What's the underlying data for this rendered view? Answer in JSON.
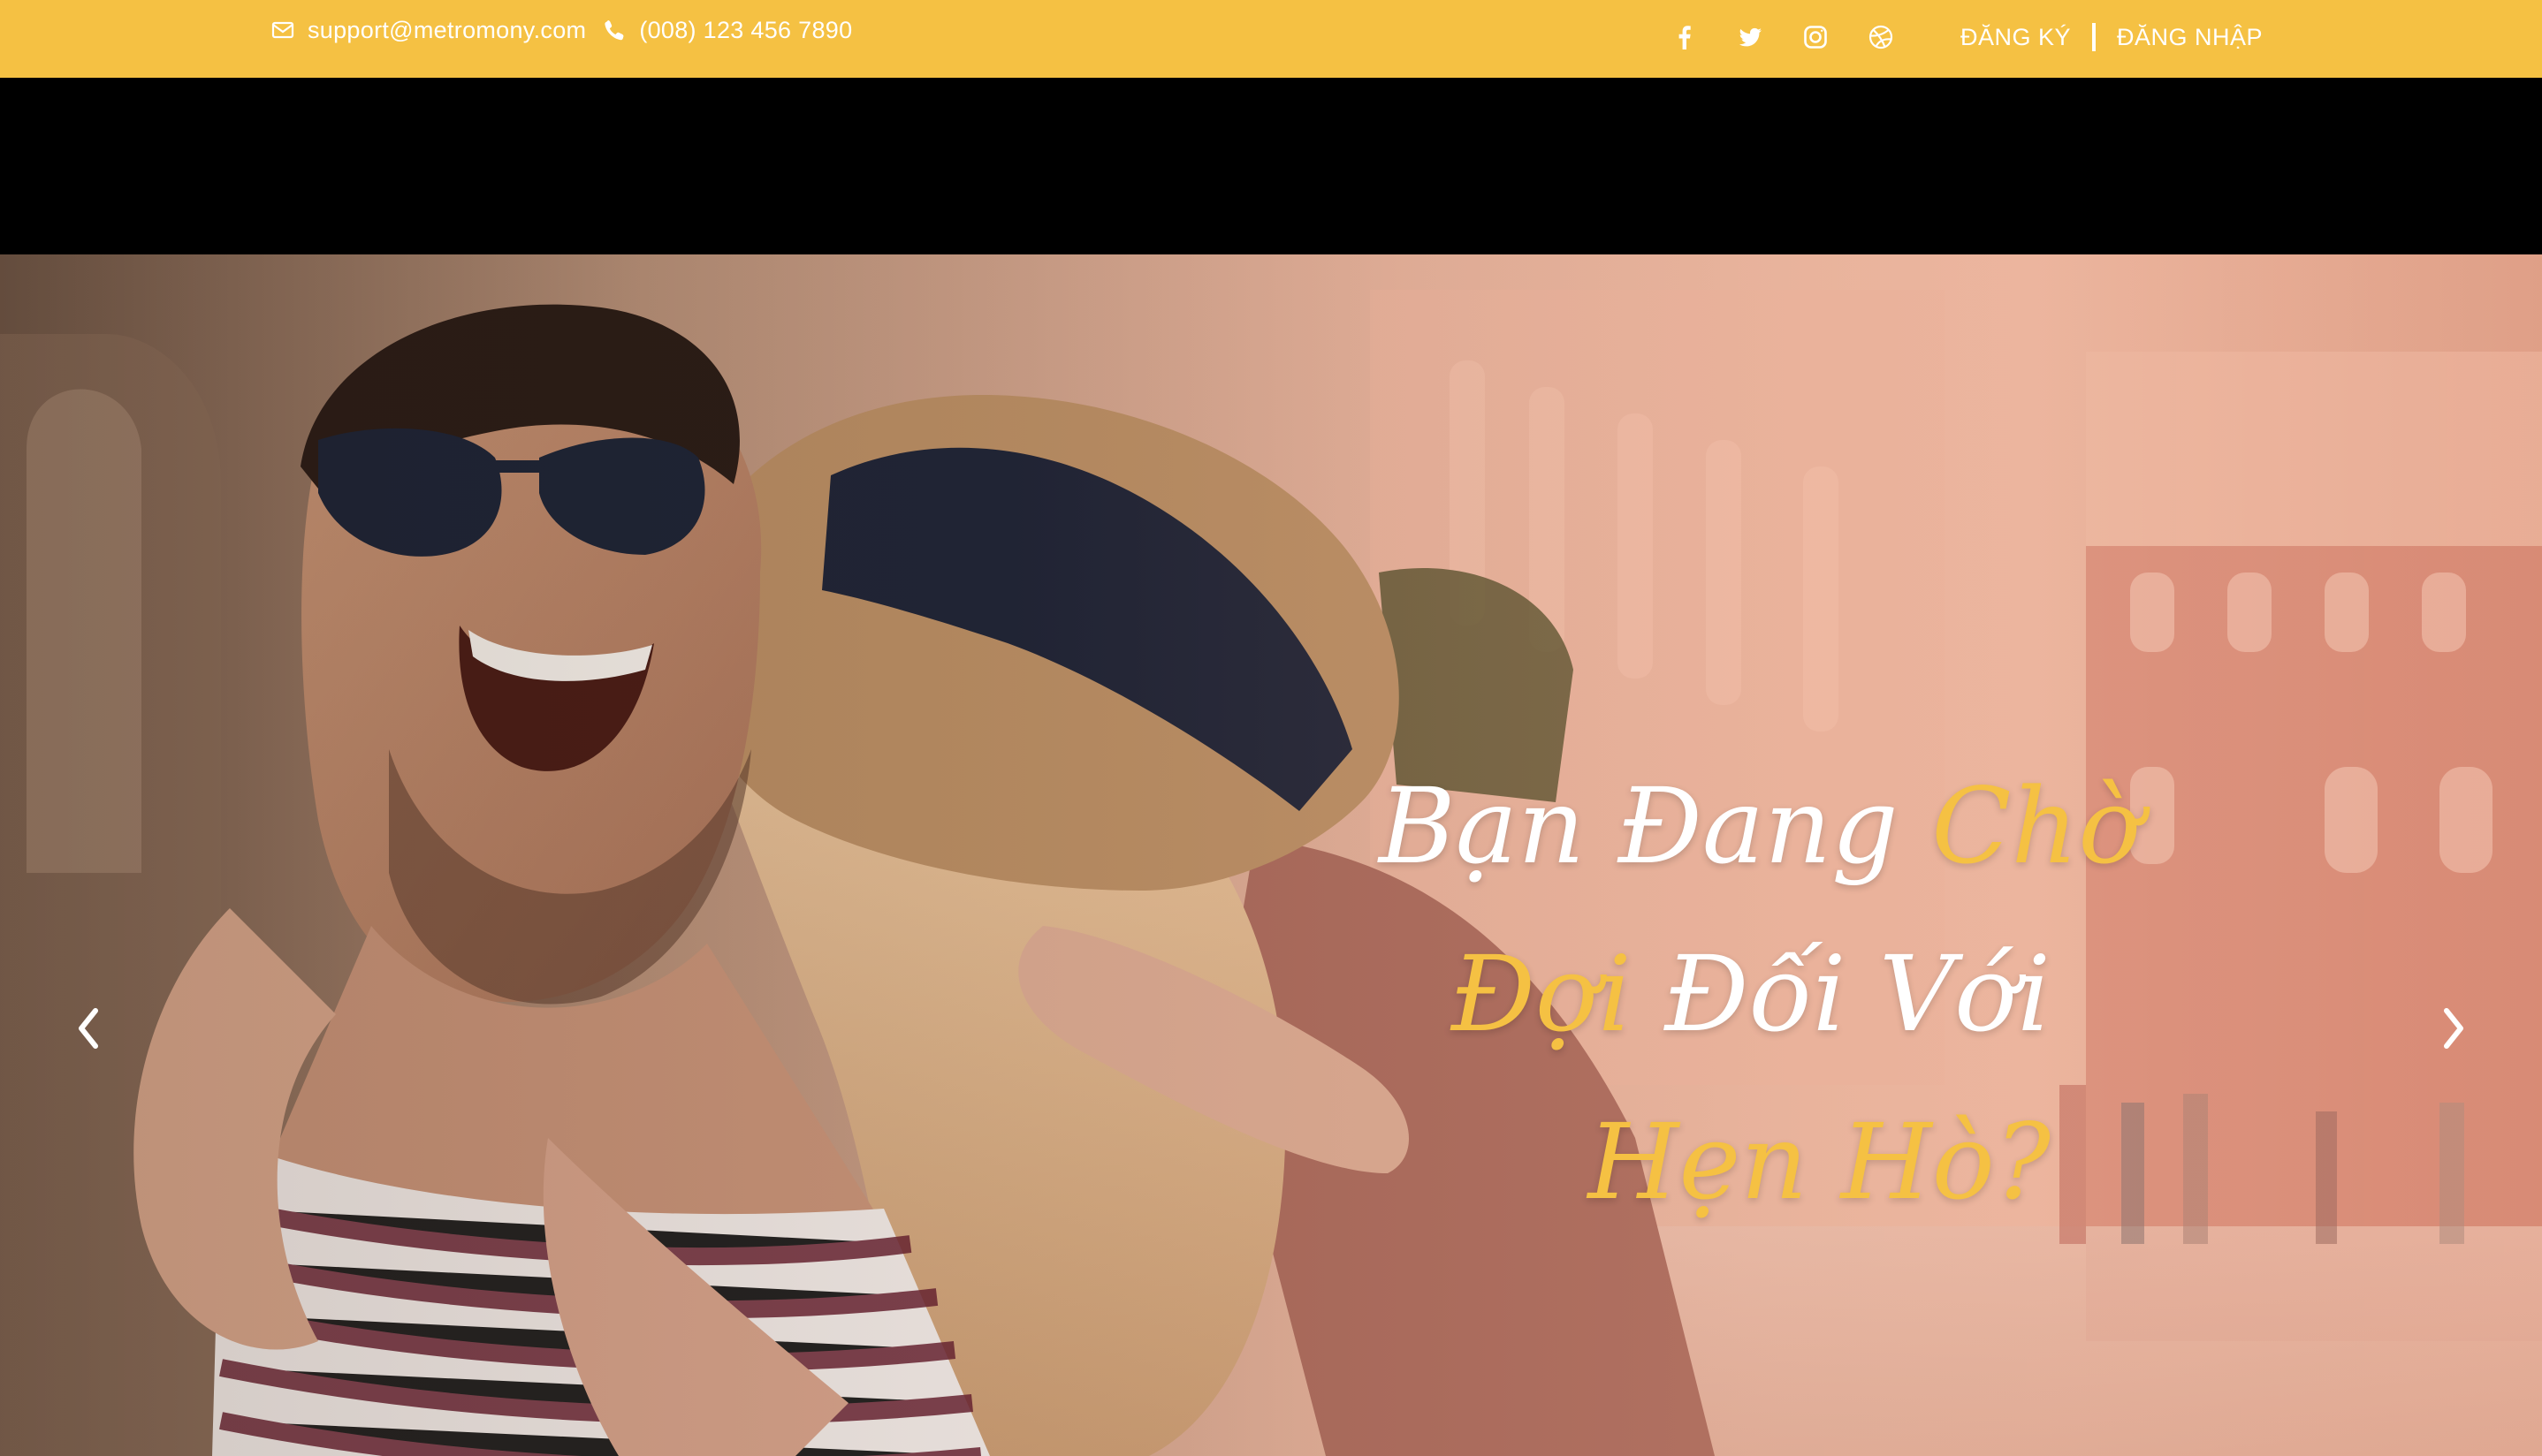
{
  "topbar": {
    "email": "support@metromony.com",
    "phone": "(008) 123 456 7890",
    "email_icon": "envelope-icon",
    "phone_icon": "phone-icon",
    "socials": [
      {
        "name": "facebook",
        "icon": "facebook-icon"
      },
      {
        "name": "twitter",
        "icon": "twitter-icon"
      },
      {
        "name": "instagram",
        "icon": "instagram-icon"
      },
      {
        "name": "dribbble",
        "icon": "dribbble-icon"
      }
    ],
    "register_label": "ĐĂNG KÝ",
    "login_label": "ĐĂNG NHẬP"
  },
  "hero": {
    "headline": {
      "line1_white": "Bạn Đang ",
      "line1_gold": "Chờ",
      "line2_gold": "Đợi",
      "line2_white": " Đối Với",
      "line3_gold": "Hẹn Hò?"
    },
    "prev_icon": "chevron-left-icon",
    "next_icon": "chevron-right-icon"
  },
  "colors": {
    "accent": "#f5c143",
    "text_light": "#ffffff",
    "nav_background": "#000000"
  }
}
